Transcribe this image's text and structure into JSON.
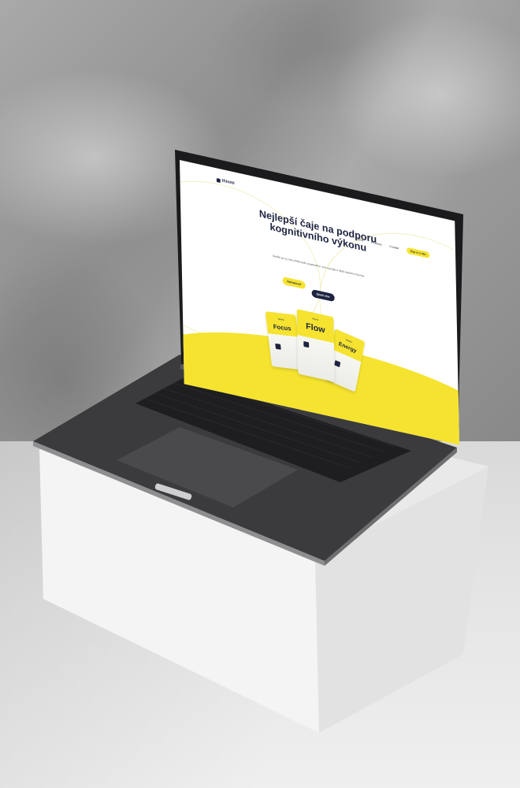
{
  "site": {
    "logo_text": "thinmi",
    "nav": [
      {
        "label": "Domů"
      },
      {
        "label": "Produkty"
      },
      {
        "label": "Kontakt"
      }
    ],
    "nav_cta": "Kup si u nás",
    "hero_title": "Nejlepší čaje na podporu kognitivního výkonu",
    "hero_subtitle": "Skvělé pro ty, kdo chtějí lepší soustředění, více energie a lepší kognitivní funkce.",
    "buttons": {
      "primary": "Nakupovat",
      "secondary": "Zjistit více"
    },
    "products": [
      {
        "name": "Focus",
        "brand": "thinmi"
      },
      {
        "name": "Flow",
        "brand": "thinmi"
      },
      {
        "name": "Energy",
        "brand": "thinmi"
      }
    ]
  },
  "colors": {
    "brand_yellow": "#f5e330",
    "brand_navy": "#1d2340",
    "laptop_body": "#3a3a3c",
    "pedestal": "#f1f1f1"
  }
}
